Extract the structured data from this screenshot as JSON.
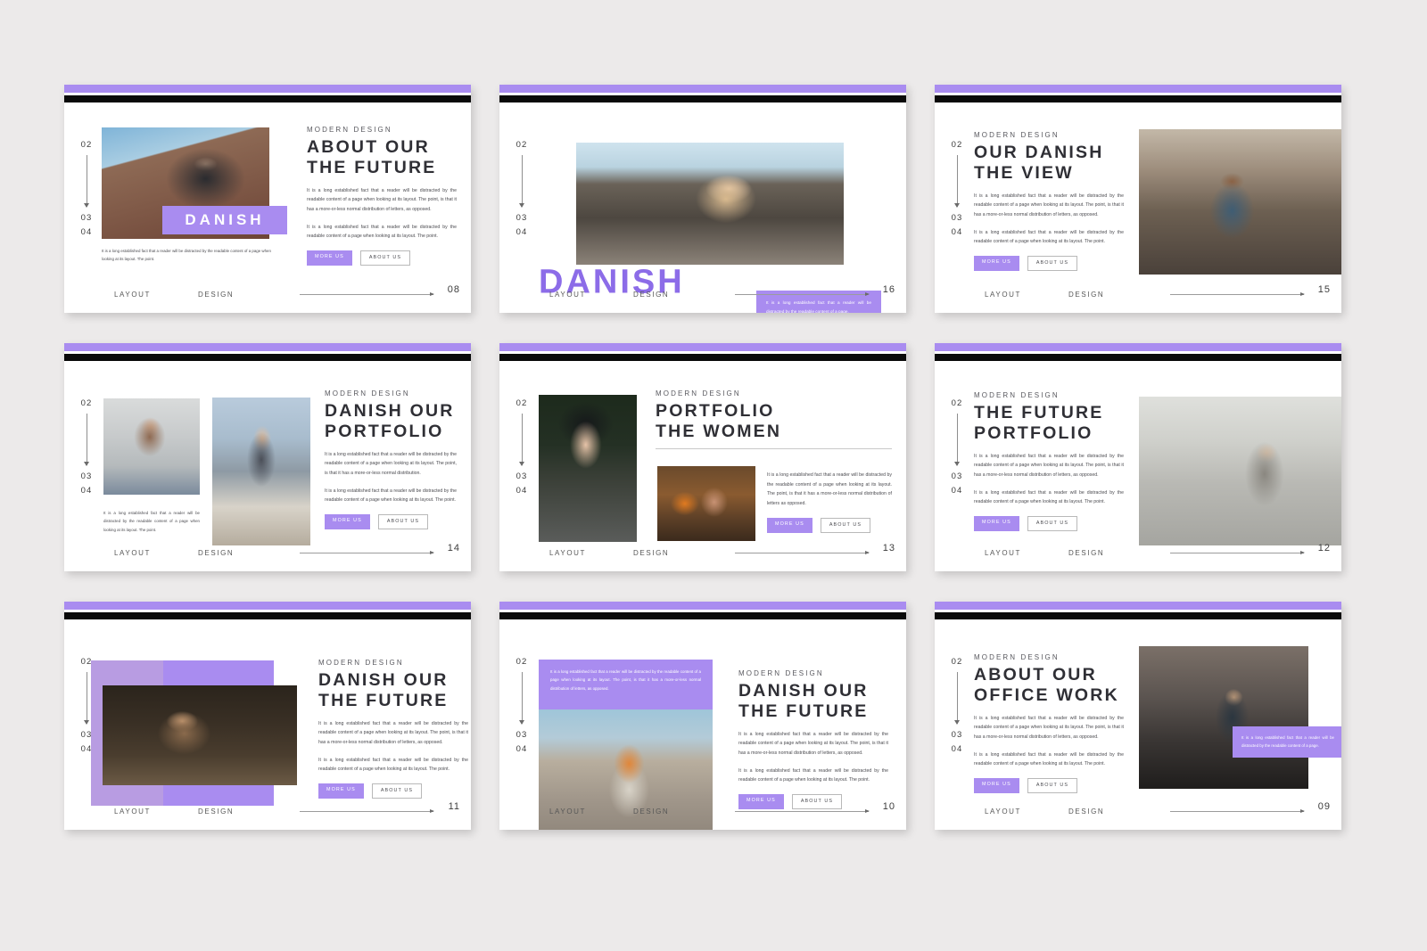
{
  "meta": {
    "accent_purple": "#a98cf0",
    "accent_purple_dark": "#b194e0",
    "black_bar": "#0a0a0a",
    "background": "#eceaea"
  },
  "common": {
    "eyebrow": "MODERN DESIGN",
    "rail": {
      "top": "02",
      "mid": "03",
      "bottom": "04"
    },
    "footer": {
      "left": "LAYOUT",
      "center": "DESIGN"
    },
    "buttons": {
      "more": "MORE US",
      "about": "ABOUT US"
    },
    "paragraph_long": "It is a long established fact that a reader will be distracted by the readable content of a page when looking at its layout. The point, is that it has a more-or-less normal distribution of letters, as opposed.",
    "paragraph_short": "It is a long established fact that a reader will be distracted by the readable content of a page when looking at its layout. The point.",
    "paragraph_tiny": "It is a long established fact that a reader will be distracted by the readable content of a page when looking at its layout. The point.",
    "callout_short": "It is a long established fact that a reader will be distracted by the readable content of a page."
  },
  "slides": [
    {
      "id": "slide-08",
      "page": "08",
      "eyebrow": "MODERN DESIGN",
      "title_line1": "ABOUT OUR",
      "title_line2": "THE FUTURE",
      "overlay_label": "DANISH",
      "body1": "It is a long established fact that a reader will be distracted by the readable content of a page when looking at its layout. The point, is that it has a more-or-less normal distribution of letters, as opposed.",
      "body2": "It is a long established fact that a reader will be distracted by the readable content of a page when looking at its layout. The point.",
      "caption": "It is a long established fact that a reader will be distracted by the readable content of a page when looking at its layout. The point.",
      "btn_more": "MORE US",
      "btn_about": "ABOUT US",
      "image_name": "rock-climber-photo"
    },
    {
      "id": "slide-16",
      "page": "16",
      "overlay_label": "DANISH",
      "callout": "It is a long established fact that a reader will be distracted by the readable content of a page.",
      "image_name": "beach-woman-photo"
    },
    {
      "id": "slide-15",
      "page": "15",
      "eyebrow": "MODERN DESIGN",
      "title_line1": "OUR DANISH",
      "title_line2": "THE VIEW",
      "body1": "It is a long established fact that a reader will be distracted by the readable content of a page when looking at its layout. The point, is that it has a more-or-less normal distribution of letters, as opposed.",
      "body2": "It is a long established fact that a reader will be distracted by the readable content of a page when looking at its layout. The point.",
      "btn_more": "MORE US",
      "btn_about": "ABOUT US",
      "image_name": "city-street-man-photo"
    },
    {
      "id": "slide-14",
      "page": "14",
      "eyebrow": "MODERN DESIGN",
      "title_line1": "DANISH OUR",
      "title_line2": "PORTFOLIO",
      "body1": "It is a long established fact that a reader will be distracted by the readable content of a page when looking at its layout. The point, is that it has a more-or-less normal distribution.",
      "body2": "It is a long established fact that a reader will be distracted by the readable content of a page when looking at its layout. The point.",
      "caption": "It is a long established fact that a reader will be distracted by the readable content of a page when looking at its layout. The point.",
      "btn_more": "MORE US",
      "btn_about": "ABOUT US",
      "image_name_a": "woman-building-photo",
      "image_name_b": "woman-coffee-lake-photo"
    },
    {
      "id": "slide-13",
      "page": "13",
      "eyebrow": "MODERN DESIGN",
      "title_line1": "PORTFOLIO",
      "title_line2": "THE WOMEN",
      "body1": "It is a long established fact that a reader will be distracted by the readable content of a page when looking at its layout. The point, is that it has a more-or-less normal distribution of letters as opposed.",
      "btn_more": "MORE US",
      "btn_about": "ABOUT US",
      "image_name_a": "woman-black-hat-photo",
      "image_name_b": "woman-pumpkins-photo"
    },
    {
      "id": "slide-12",
      "page": "12",
      "eyebrow": "MODERN DESIGN",
      "title_line1": "THE FUTURE",
      "title_line2": "PORTFOLIO",
      "body1": "It is a long established fact that a reader will be distracted by the readable content of a page when looking at its layout. The point, is that it has a more-or-less normal distribution of letters, as opposed.",
      "body2": "It is a long established fact that a reader will be distracted by the readable content of a page when looking at its layout. The point.",
      "btn_more": "MORE US",
      "btn_about": "ABOUT US",
      "image_name": "woman-street-backpack-photo"
    },
    {
      "id": "slide-11",
      "page": "11",
      "eyebrow": "MODERN DESIGN",
      "title_line1": "DANISH OUR",
      "title_line2": "THE FUTURE",
      "body1": "It is a long established fact that a reader will be distracted by the readable content of a page when looking at its layout. The point, is that it has a more-or-less normal distribution of letters, as opposed.",
      "body2": "It is a long established fact that a reader will be distracted by the readable content of a page when looking at its layout. The point.",
      "btn_more": "MORE US",
      "btn_about": "ABOUT US",
      "image_name": "woman-laughing-couch-photo"
    },
    {
      "id": "slide-10",
      "page": "10",
      "eyebrow": "MODERN DESIGN",
      "title_line1": "DANISH OUR",
      "title_line2": "THE FUTURE",
      "callout": "It is a long established fact that a reader will be distracted by the readable content of a page when looking at its layout. The point, is that it has a more-or-less normal distribution of letters, as opposed.",
      "body1": "It is a long established fact that a reader will be distracted by the readable content of a page when looking at its layout. The point, is that it has a more-or-less normal distribution of letters, as opposed.",
      "body2": "It is a long established fact that a reader will be distracted by the readable content of a page when looking at its layout. The point.",
      "btn_more": "MORE US",
      "btn_about": "ABOUT US",
      "image_name": "woman-concrete-blocks-photo"
    },
    {
      "id": "slide-09",
      "page": "09",
      "eyebrow": "MODERN DESIGN",
      "title_line1": "ABOUT OUR",
      "title_line2": "OFFICE WORK",
      "body1": "It is a long established fact that a reader will be distracted by the readable content of a page when looking at its layout. The point, is that it has a more-or-less normal distribution of letters, as opposed.",
      "body2": "It is a long established fact that a reader will be distracted by the readable content of a page when looking at its layout. The point.",
      "callout": "It is a long established fact that a reader will be distracted by the readable content of a page.",
      "btn_more": "MORE US",
      "btn_about": "ABOUT US",
      "image_name": "barista-cafe-photo"
    }
  ]
}
